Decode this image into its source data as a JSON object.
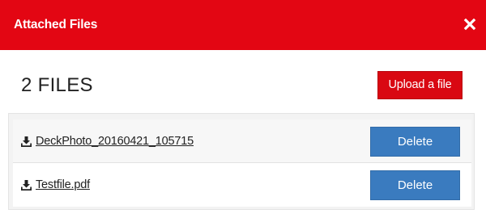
{
  "header": {
    "title": "Attached Files",
    "close_icon": "close-icon",
    "background_color": "#e30613"
  },
  "summary": {
    "file_count_label": "2 FILES",
    "upload_label": "Upload a file"
  },
  "files": [
    {
      "name": "DeckPhoto_20160421_105715",
      "action_label": "Delete",
      "icon": "download-icon"
    },
    {
      "name": "Testfile.pdf",
      "action_label": "Delete",
      "icon": "download-icon"
    }
  ],
  "colors": {
    "upload_button": "#d90812",
    "delete_button": "#3a7bbf"
  }
}
